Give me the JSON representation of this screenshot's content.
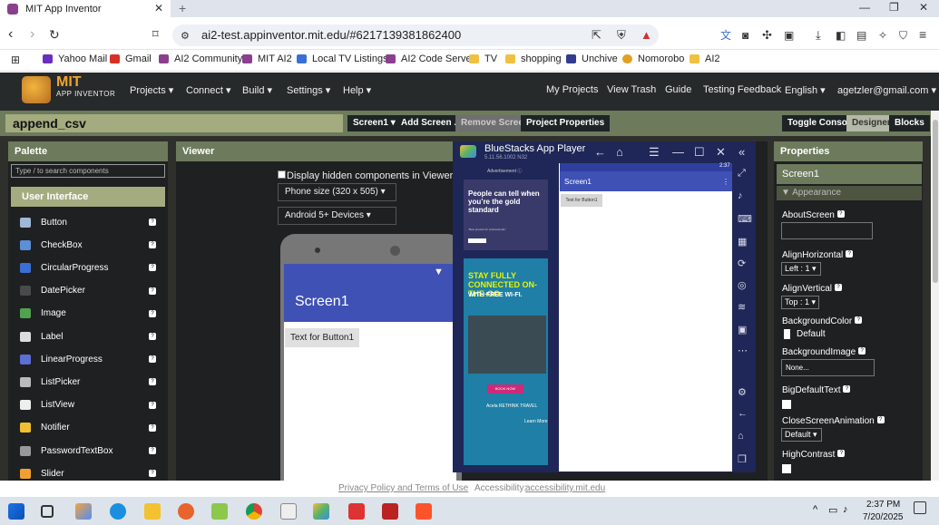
{
  "browser": {
    "tab_title": "MIT App Inventor",
    "tab_close": "✕",
    "new_tab": "+",
    "url": "ai2-test.appinventor.mit.edu/#6217139381862400",
    "bookmarks": [
      "Yahoo Mail",
      "Gmail",
      "AI2 Community",
      "MIT AI2",
      "Local TV Listings",
      "AI2 Code Server",
      "TV",
      "shopping",
      "Unchive",
      "Nomorobo",
      "AI2"
    ]
  },
  "app_header": {
    "logo_title": "MIT",
    "logo_subtitle": "APP INVENTOR",
    "menus": [
      "Projects ▾",
      "Connect ▾",
      "Build ▾",
      "Settings ▾",
      "Help ▾"
    ],
    "right_links": [
      "My Projects",
      "View Trash",
      "Guide",
      "Testing Feedback",
      "English ▾",
      "agetzler@gmail.com ▾"
    ]
  },
  "project_bar": {
    "project_name": "append_csv",
    "screen_select": "Screen1 ▾",
    "add_screen": "Add Screen ...",
    "remove_screen": "Remove Screen",
    "project_properties": "Project Properties",
    "toggle_console": "Toggle Console",
    "designer": "Designer",
    "blocks": "Blocks"
  },
  "palette": {
    "title": "Palette",
    "search_placeholder": "Type / to search components",
    "section": "User Interface",
    "items": [
      {
        "label": "Button",
        "icon": "button-icon",
        "color": "#9fb8d8"
      },
      {
        "label": "CheckBox",
        "icon": "checkbox-icon",
        "color": "#5b8fd6"
      },
      {
        "label": "CircularProgress",
        "icon": "circular-progress-icon",
        "color": "#3b6fd6"
      },
      {
        "label": "DatePicker",
        "icon": "date-picker-icon",
        "color": "#4a4a4a"
      },
      {
        "label": "Image",
        "icon": "image-icon",
        "color": "#4fa34f"
      },
      {
        "label": "Label",
        "icon": "label-icon",
        "color": "#dddddd"
      },
      {
        "label": "LinearProgress",
        "icon": "linear-progress-icon",
        "color": "#5b6fd6"
      },
      {
        "label": "ListPicker",
        "icon": "list-picker-icon",
        "color": "#bbbbbb"
      },
      {
        "label": "ListView",
        "icon": "list-view-icon",
        "color": "#eeeeee"
      },
      {
        "label": "Notifier",
        "icon": "notifier-icon",
        "color": "#f0c030"
      },
      {
        "label": "PasswordTextBox",
        "icon": "password-textbox-icon",
        "color": "#999999"
      },
      {
        "label": "Slider",
        "icon": "slider-icon",
        "color": "#f0a030"
      }
    ],
    "help": "?"
  },
  "viewer": {
    "title": "Viewer",
    "hidden_label": "Display hidden components in Viewer",
    "size_select": "Phone size (320 x 505) ▾",
    "device_select": "Android 5+ Devices ▾",
    "screen_title": "Screen1",
    "button_text": "Text for Button1"
  },
  "bluestacks": {
    "title": "BlueStacks App Player",
    "version": "5.11.56.1002  N32",
    "ad_label": "Advertisement ⓘ",
    "ad1_text": "People can tell when you’re the gold standard",
    "ad1_sub": "“Best product for professionals”",
    "ad2_title": "STAY FULLY CONNECTED ON-THE-GO",
    "ad2_sub": "WITH FREE WI-FI.",
    "ad2_button": "BOOK NOW",
    "ad2_brand": "Acela  RETHINK TRAVEL",
    "ad3_learn": "Learn More",
    "emu_time": "2:37",
    "emu_title": "Screen1",
    "emu_button": "Text for Button1"
  },
  "properties": {
    "title": "Properties",
    "screen": "Screen1",
    "appearance": "Appearance",
    "about_screen": "AboutScreen",
    "align_horizontal": "AlignHorizontal",
    "align_horizontal_value": "Left : 1 ▾",
    "align_vertical": "AlignVertical",
    "align_vertical_value": "Top : 1 ▾",
    "background_color": "BackgroundColor",
    "background_color_value": "Default",
    "background_image": "BackgroundImage",
    "background_image_value": "None...",
    "big_default_text": "BigDefaultText",
    "close_screen_animation": "CloseScreenAnimation",
    "close_screen_animation_value": "Default ▾",
    "high_contrast": "HighContrast"
  },
  "footer": {
    "privacy": "Privacy Policy and Terms of Use",
    "accessibility_label": "Accessibility:",
    "accessibility_link": "accessibility.mit.edu"
  },
  "taskbar": {
    "time": "2:37 PM",
    "date": "7/20/2025"
  }
}
